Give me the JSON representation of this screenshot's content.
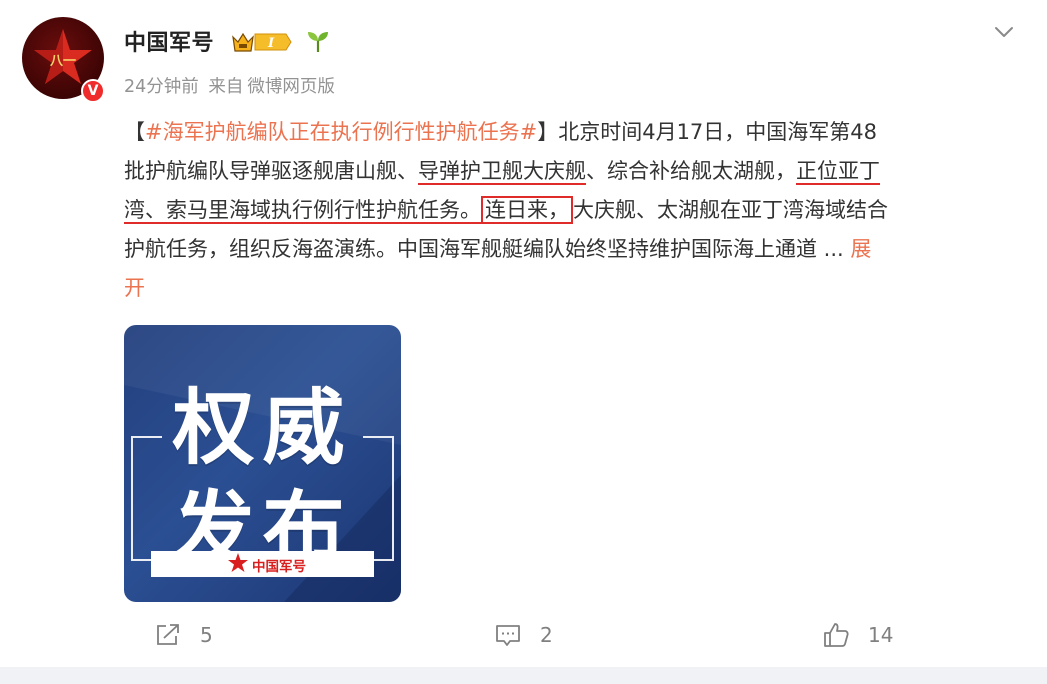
{
  "post": {
    "author": {
      "name": "中国军号",
      "verified_badge": "V",
      "avatar_icon": "red-star-emblem-icon",
      "vip_icon": "crown-vip-icon",
      "vip_level": "I",
      "extra_icon": "sprout-icon"
    },
    "meta": {
      "time": "24分钟前",
      "source_prefix": "来自",
      "source": "微博网页版"
    },
    "menu_icon": "chevron-down-icon",
    "text": {
      "l1_open": "【",
      "l1_hashtag": "#海军护航编队正在执行例行性护航任务#",
      "l1_close": "】北京时间4月17日，中国海军第48",
      "l2_a": "批护航编队导弹驱逐舰唐山舰、",
      "l2_b": "导弹护卫舰大庆舰",
      "l2_c": "、综合补给舰太湖舰，",
      "l2_d": "正位亚丁",
      "l3_a": "湾、索马里海域执行例行性护航任务。",
      "l3_box": "连日来，",
      "l3_b": "大庆舰、太湖舰在亚丁湾海域结合",
      "l4": "护航任务，组织反海盗演练。中国海军舰艇编队始终坚持维护国际海上通道",
      "ellipsis": " ...",
      "expand_1": "展",
      "expand_2": "开"
    },
    "image": {
      "line1": "权威",
      "line2": "发布",
      "logo_text": "中国军号"
    },
    "actions": {
      "repost_icon": "repost-icon",
      "repost_count": "5",
      "comment_icon": "comment-icon",
      "comment_count": "2",
      "like_icon": "thumbs-up-icon",
      "like_count": "14"
    }
  },
  "colors": {
    "hashtag": "#eb7350",
    "annotation_red": "#e02b2b",
    "verified_red": "#ef2b2b",
    "image_blue": "#2b4f93",
    "meta_gray": "#939393"
  }
}
